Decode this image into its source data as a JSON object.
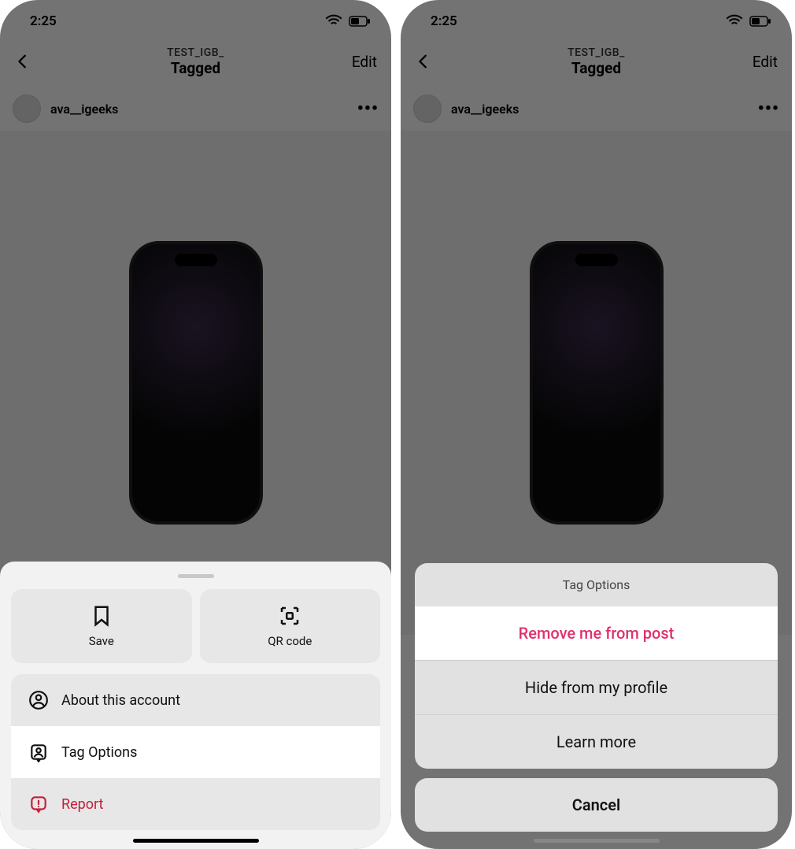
{
  "status": {
    "time": "2:25"
  },
  "header": {
    "subtitle": "TEST_IGB_",
    "title": "Tagged",
    "edit_label": "Edit"
  },
  "post": {
    "username": "ava__igeeks",
    "more_glyph": "•••"
  },
  "sheet1": {
    "save_label": "Save",
    "qr_label": "QR code",
    "about_label": "About this account",
    "tag_options_label": "Tag Options",
    "report_label": "Report"
  },
  "sheet2": {
    "title": "Tag Options",
    "remove_label": "Remove me from post",
    "hide_label": "Hide from my profile",
    "learn_label": "Learn more",
    "cancel_label": "Cancel"
  },
  "colors": {
    "accent": "#e1306c",
    "danger": "#c1203a"
  }
}
